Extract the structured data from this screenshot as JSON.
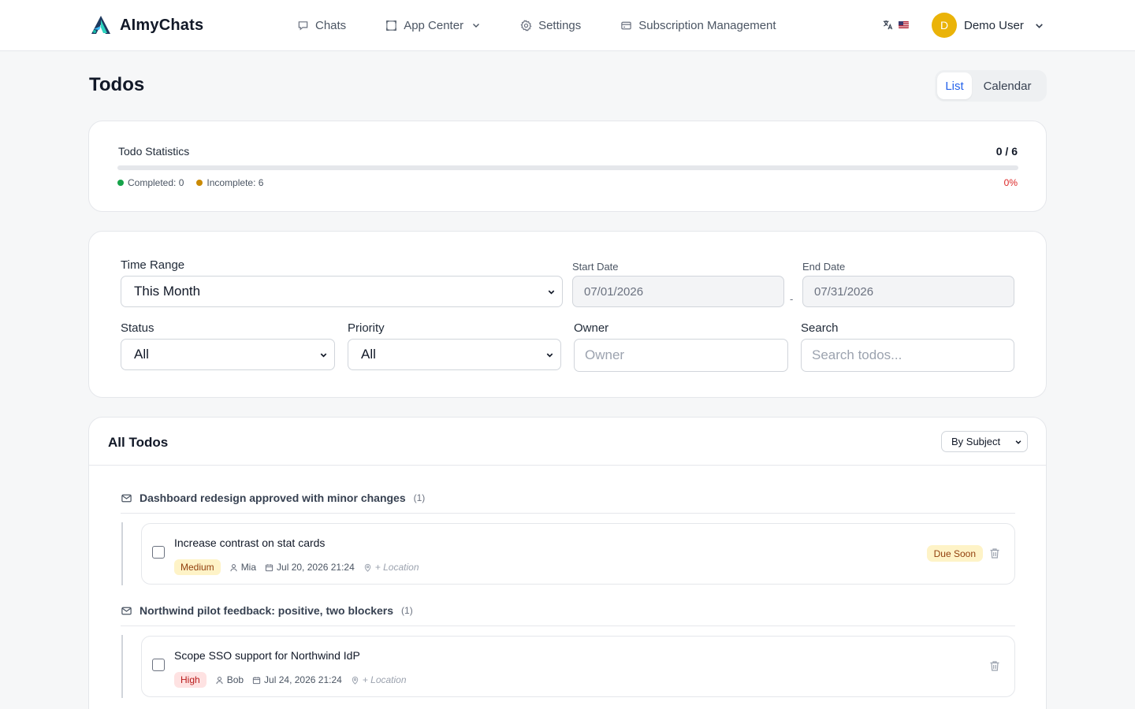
{
  "header": {
    "brand": "AImyChats",
    "nav": [
      {
        "label": "Chats",
        "icon": "chat-bubble-icon"
      },
      {
        "label": "App Center",
        "icon": "app-center-icon",
        "has_dropdown": true
      },
      {
        "label": "Settings",
        "icon": "gear-icon"
      },
      {
        "label": "Subscription Management",
        "icon": "credit-card-icon"
      }
    ],
    "language_flag": "us-flag",
    "user": {
      "initial": "D",
      "name": "Demo User"
    }
  },
  "page": {
    "title": "Todos",
    "view_toggle": {
      "list": "List",
      "calendar": "Calendar",
      "active": "List"
    }
  },
  "stats": {
    "label": "Todo Statistics",
    "count": "0 / 6",
    "completed": "Completed: 0",
    "incomplete": "Incomplete: 6",
    "percent": "0%",
    "progress_fraction": 0,
    "colors": {
      "completed": "#16a34a",
      "incomplete": "#ca8a04",
      "percent": "#dc2626"
    }
  },
  "filters": {
    "time_range": {
      "label": "Time Range",
      "value": "This Month"
    },
    "start_date": {
      "label": "Start Date",
      "value": "07/01/2026"
    },
    "date_separator": "-",
    "end_date": {
      "label": "End Date",
      "value": "07/31/2026"
    },
    "status": {
      "label": "Status",
      "value": "All"
    },
    "priority": {
      "label": "Priority",
      "value": "All"
    },
    "owner": {
      "label": "Owner",
      "placeholder": "Owner"
    },
    "search": {
      "label": "Search",
      "placeholder": "Search todos..."
    }
  },
  "todos": {
    "title": "All Todos",
    "group_by": "By Subject",
    "groups": [
      {
        "subject": "Dashboard redesign approved with minor changes",
        "count": "(1)",
        "items": [
          {
            "title": "Increase contrast on stat cards",
            "priority": "Medium",
            "owner": "Mia",
            "date": "Jul 20, 2026 21:24",
            "location": "+ Location",
            "status_badge": "Due Soon"
          }
        ]
      },
      {
        "subject": "Northwind pilot feedback: positive, two blockers",
        "count": "(1)",
        "items": [
          {
            "title": "Scope SSO support for Northwind IdP",
            "priority": "High",
            "owner": "Bob",
            "date": "Jul 24, 2026 21:24",
            "location": "+ Location"
          }
        ]
      }
    ]
  }
}
